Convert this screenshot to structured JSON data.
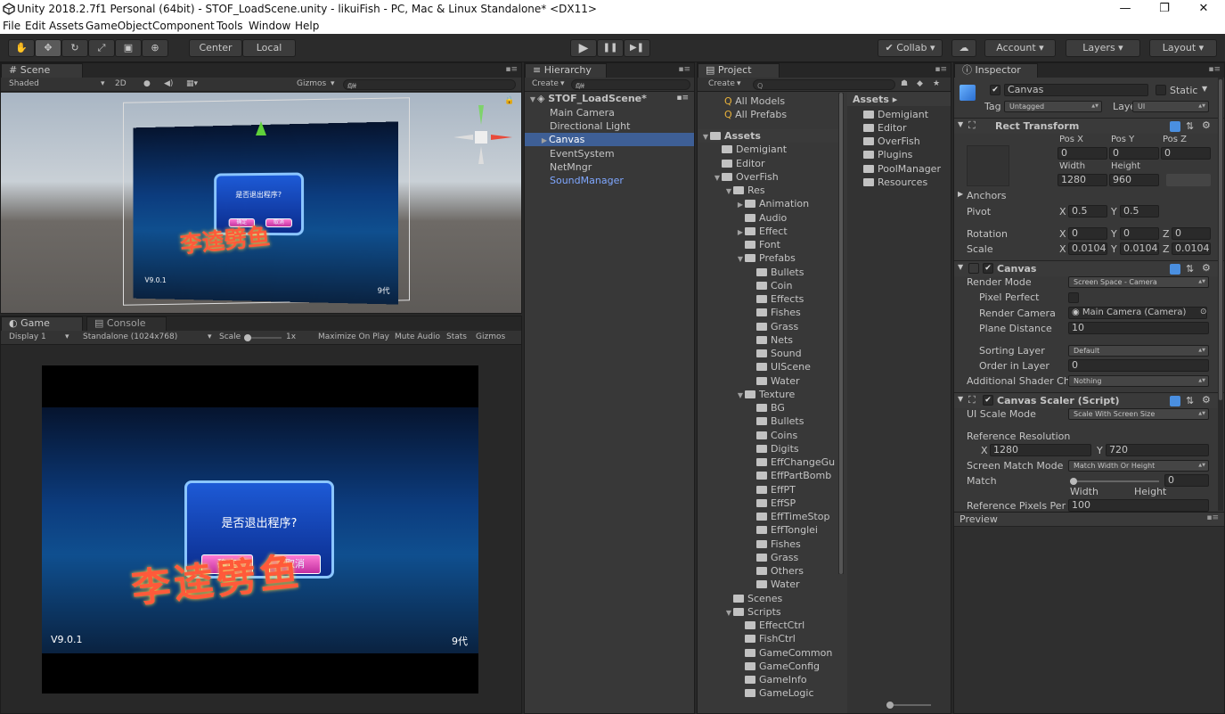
{
  "window": {
    "title": "Unity 2018.2.7f1 Personal (64bit) - STOF_LoadScene.unity - likuiFish - PC, Mac & Linux Standalone* <DX11>",
    "min": "—",
    "max": "❐",
    "close": "✕"
  },
  "menu": [
    "File",
    "Edit",
    "Assets",
    "GameObject",
    "Component",
    "Tools",
    "Window",
    "Help"
  ],
  "toolbar": {
    "center": "Center",
    "local": "Local",
    "play": "▶",
    "pause": "❚❚",
    "step": "▶❚",
    "collab": "Collab",
    "account": "Account",
    "layers": "Layers",
    "layout": "Layout"
  },
  "scene": {
    "tab": "Scene",
    "shaded": "Shaded",
    "mode2d": "2D",
    "gizmos": "Gizmos",
    "search": "All"
  },
  "game": {
    "tab": "Game",
    "console_tab": "Console",
    "display": "Display 1",
    "resolution": "Standalone (1024x768)",
    "scale_label": "Scale",
    "scale_value": "1x",
    "maximize": "Maximize On Play",
    "mute": "Mute Audio",
    "stats": "Stats",
    "gizmos": "Gizmos"
  },
  "game_view": {
    "dialog_text": "是否退出程序?",
    "ok": "确定",
    "cancel": "取消",
    "version": "V9.0.1",
    "corner": "9代",
    "logo": "李逵劈鱼"
  },
  "scene_view": {
    "version": "V9.0.1",
    "corner": "9代",
    "dialog_text": "是否退出程序?",
    "ok": "确定",
    "cancel": "取消"
  },
  "hierarchy": {
    "tab": "Hierarchy",
    "create": "Create",
    "search": "All",
    "scene_name": "STOF_LoadScene*",
    "items": [
      "Main Camera",
      "Directional Light",
      "Canvas",
      "EventSystem",
      "NetMngr",
      "SoundManager"
    ]
  },
  "project": {
    "tab": "Project",
    "create": "Create",
    "favorites": [
      "All Models",
      "All Prefabs"
    ],
    "tree": [
      {
        "label": "Assets",
        "d": 0,
        "arrow": "▼"
      },
      {
        "label": "Demigiant",
        "d": 1,
        "arrow": ""
      },
      {
        "label": "Editor",
        "d": 1,
        "arrow": ""
      },
      {
        "label": "OverFish",
        "d": 1,
        "arrow": "▼"
      },
      {
        "label": "Res",
        "d": 2,
        "arrow": "▼"
      },
      {
        "label": "Animation",
        "d": 3,
        "arrow": "▶"
      },
      {
        "label": "Audio",
        "d": 3,
        "arrow": ""
      },
      {
        "label": "Effect",
        "d": 3,
        "arrow": "▶"
      },
      {
        "label": "Font",
        "d": 3,
        "arrow": ""
      },
      {
        "label": "Prefabs",
        "d": 3,
        "arrow": "▼"
      },
      {
        "label": "Bullets",
        "d": 4,
        "arrow": ""
      },
      {
        "label": "Coin",
        "d": 4,
        "arrow": ""
      },
      {
        "label": "Effects",
        "d": 4,
        "arrow": ""
      },
      {
        "label": "Fishes",
        "d": 4,
        "arrow": ""
      },
      {
        "label": "Grass",
        "d": 4,
        "arrow": ""
      },
      {
        "label": "Nets",
        "d": 4,
        "arrow": ""
      },
      {
        "label": "Sound",
        "d": 4,
        "arrow": ""
      },
      {
        "label": "UIScene",
        "d": 4,
        "arrow": ""
      },
      {
        "label": "Water",
        "d": 4,
        "arrow": ""
      },
      {
        "label": "Texture",
        "d": 3,
        "arrow": "▼"
      },
      {
        "label": "BG",
        "d": 4,
        "arrow": ""
      },
      {
        "label": "Bullets",
        "d": 4,
        "arrow": ""
      },
      {
        "label": "Coins",
        "d": 4,
        "arrow": ""
      },
      {
        "label": "Digits",
        "d": 4,
        "arrow": ""
      },
      {
        "label": "EffChangeGu",
        "d": 4,
        "arrow": ""
      },
      {
        "label": "EffPartBomb",
        "d": 4,
        "arrow": ""
      },
      {
        "label": "EffPT",
        "d": 4,
        "arrow": ""
      },
      {
        "label": "EffSP",
        "d": 4,
        "arrow": ""
      },
      {
        "label": "EffTimeStop",
        "d": 4,
        "arrow": ""
      },
      {
        "label": "EffTonglei",
        "d": 4,
        "arrow": ""
      },
      {
        "label": "Fishes",
        "d": 4,
        "arrow": ""
      },
      {
        "label": "Grass",
        "d": 4,
        "arrow": ""
      },
      {
        "label": "Others",
        "d": 4,
        "arrow": ""
      },
      {
        "label": "Water",
        "d": 4,
        "arrow": ""
      },
      {
        "label": "Scenes",
        "d": 2,
        "arrow": ""
      },
      {
        "label": "Scripts",
        "d": 2,
        "arrow": "▼"
      },
      {
        "label": "EffectCtrl",
        "d": 3,
        "arrow": ""
      },
      {
        "label": "FishCtrl",
        "d": 3,
        "arrow": ""
      },
      {
        "label": "GameCommon",
        "d": 3,
        "arrow": ""
      },
      {
        "label": "GameConfig",
        "d": 3,
        "arrow": ""
      },
      {
        "label": "GameInfo",
        "d": 3,
        "arrow": ""
      },
      {
        "label": "GameLogic",
        "d": 3,
        "arrow": ""
      }
    ],
    "assets_header": "Assets ▸",
    "assets_list": [
      "Demigiant",
      "Editor",
      "OverFish",
      "Plugins",
      "PoolManager",
      "Resources"
    ]
  },
  "inspector": {
    "tab": "Inspector",
    "name": "Canvas",
    "static": "Static",
    "tag_label": "Tag",
    "tag": "Untagged",
    "layer_label": "Layer",
    "layer": "UI",
    "rect": {
      "title": "Rect Transform",
      "posx": "Pos X",
      "posy": "Pos Y",
      "posz": "Pos Z",
      "x": "0",
      "y": "0",
      "z": "0",
      "width_l": "Width",
      "height_l": "Height",
      "width": "1280",
      "height": "960",
      "anchors": "Anchors",
      "pivot": "Pivot",
      "px": "0.5",
      "py": "0.5",
      "rotation": "Rotation",
      "rx": "0",
      "ry": "0",
      "rz": "0",
      "scale": "Scale",
      "sx": "0.0104",
      "sy": "0.0104",
      "sz": "0.0104",
      "X": "X",
      "Y": "Y",
      "Z": "Z"
    },
    "canvas": {
      "title": "Canvas",
      "render_mode_l": "Render Mode",
      "render_mode": "Screen Space - Camera",
      "pixel_perfect": "Pixel Perfect",
      "render_camera_l": "Render Camera",
      "render_camera": "Main Camera (Camera)",
      "plane_distance_l": "Plane Distance",
      "plane_distance": "10",
      "sorting_layer_l": "Sorting Layer",
      "sorting_layer": "Default",
      "order_l": "Order in Layer",
      "order": "0",
      "additional_l": "Additional Shader Ch",
      "additional": "Nothing"
    },
    "scaler": {
      "title": "Canvas Scaler (Script)",
      "ui_scale_l": "UI Scale Mode",
      "ui_scale": "Scale With Screen Size",
      "ref_l": "Reference Resolution",
      "rx": "1280",
      "ry": "720",
      "match_mode_l": "Screen Match Mode",
      "match_mode": "Match Width Or Height",
      "match_l": "Match",
      "match": "0",
      "width": "Width",
      "height": "Height",
      "match_fraction": 0,
      "ref_pixels": "Reference Pixels Per U",
      "ref_pixels_v": "100"
    },
    "preview": "Preview"
  },
  "colors": {
    "selection": "#3e5f96",
    "dialog": "#1d5ad6",
    "button": "#e048b8"
  }
}
